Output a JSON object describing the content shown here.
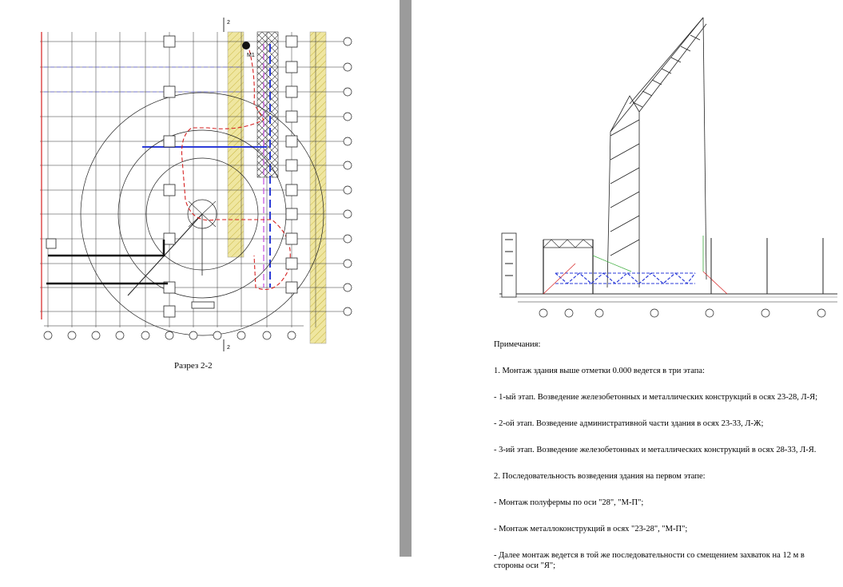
{
  "left_page": {
    "caption": "Разрез 2-2",
    "marker_top": "2",
    "marker_bottom": "2",
    "crane_label": "М1"
  },
  "right_page": {
    "notes_title": "Примечания:",
    "paragraphs": [
      "1. Монтаж здания выше отметки 0.000 ведется в три этапа:",
      "- 1-ый этап. Возведение железобетонных и металлических конструкций в осях 23-28, Л-Я;",
      "- 2-ой этап. Возведение административной части здания в осях 23-33, Л-Ж;",
      "- 3-ий этап. Возведение железобетонных и металлических конструкций в осях 28-33, Л-Я.",
      "2. Последовательность возведения здания на первом этапе:",
      "- Монтаж полуфермы по оси \"28\", \"М-П\";",
      "- Монтаж металлоконструкций в осях \"23-28\", \"М-П\";",
      "- Далее монтаж ведется в той же последовательности со смещением захваток на 12 м в стороны оси \"Я\";"
    ]
  },
  "colors": {
    "gutter": "#9b9b9b",
    "grid": "#000000",
    "hatch": "#e8df8a",
    "red_path": "#d62020",
    "blue_line": "#2b3bd8"
  }
}
